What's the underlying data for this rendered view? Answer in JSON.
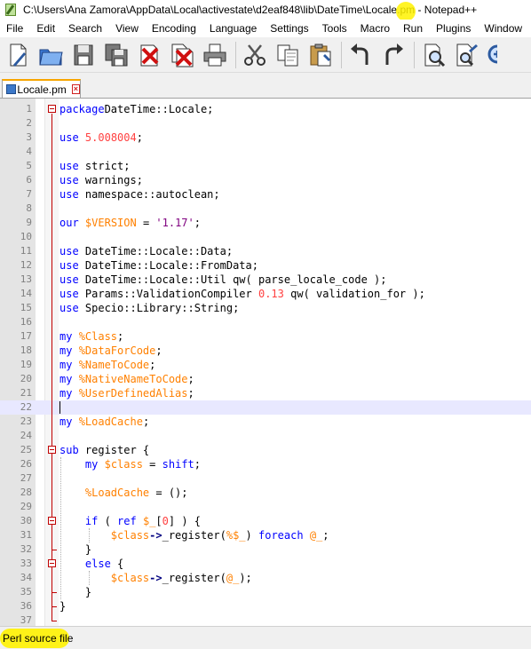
{
  "window": {
    "title": "C:\\Users\\Ana Zamora\\AppData\\Local\\activestate\\d2eaf848\\lib\\DateTime\\Locale.pm - Notepad++"
  },
  "menu": [
    "File",
    "Edit",
    "Search",
    "View",
    "Encoding",
    "Language",
    "Settings",
    "Tools",
    "Macro",
    "Run",
    "Plugins",
    "Window",
    "?"
  ],
  "toolbar": {
    "buttons": [
      "new-file-icon",
      "open-folder-icon",
      "save-icon",
      "save-all-icon",
      "close-icon",
      "close-all-icon",
      "print-icon",
      "cut-icon",
      "copy-icon",
      "paste-icon",
      "undo-icon",
      "redo-icon",
      "find-icon",
      "replace-icon",
      "zoom-icon"
    ]
  },
  "tab": {
    "label": "Locale.pm",
    "close": "×"
  },
  "editor": {
    "current_line": 22,
    "line_numbers": [
      "1",
      "2",
      "3",
      "4",
      "5",
      "6",
      "7",
      "8",
      "9",
      "10",
      "11",
      "12",
      "13",
      "14",
      "15",
      "16",
      "17",
      "18",
      "19",
      "20",
      "21",
      "22",
      "23",
      "24",
      "25",
      "26",
      "27",
      "28",
      "29",
      "30",
      "31",
      "32",
      "33",
      "34",
      "35",
      "36",
      "37"
    ],
    "lines": [
      [
        [
          "kw",
          "package"
        ],
        [
          "",
          "DateTime::Locale;"
        ]
      ],
      [],
      [
        [
          "kw",
          "use"
        ],
        [
          "",
          " "
        ],
        [
          "num",
          "5.008004"
        ],
        [
          "",
          ";"
        ]
      ],
      [],
      [
        [
          "kw",
          "use"
        ],
        [
          "",
          " strict;"
        ]
      ],
      [
        [
          "kw",
          "use"
        ],
        [
          "",
          " warnings;"
        ]
      ],
      [
        [
          "kw",
          "use"
        ],
        [
          "",
          " namespace::autoclean;"
        ]
      ],
      [],
      [
        [
          "kw",
          "our"
        ],
        [
          "",
          " "
        ],
        [
          "var",
          "$VERSION"
        ],
        [
          "",
          " = "
        ],
        [
          "str",
          "'1.17'"
        ],
        [
          "",
          ";"
        ]
      ],
      [],
      [
        [
          "kw",
          "use"
        ],
        [
          "",
          " DateTime::Locale::Data;"
        ]
      ],
      [
        [
          "kw",
          "use"
        ],
        [
          "",
          " DateTime::Locale::FromData;"
        ]
      ],
      [
        [
          "kw",
          "use"
        ],
        [
          "",
          " DateTime::Locale::Util qw( parse_locale_code );"
        ]
      ],
      [
        [
          "kw",
          "use"
        ],
        [
          "",
          " Params::ValidationCompiler "
        ],
        [
          "num",
          "0.13"
        ],
        [
          "",
          " qw( validation_for );"
        ]
      ],
      [
        [
          "kw",
          "use"
        ],
        [
          "",
          " Specio::Library::String;"
        ]
      ],
      [],
      [
        [
          "kw",
          "my"
        ],
        [
          "",
          " "
        ],
        [
          "var",
          "%Class"
        ],
        [
          "",
          ";"
        ]
      ],
      [
        [
          "kw",
          "my"
        ],
        [
          "",
          " "
        ],
        [
          "var",
          "%DataForCode"
        ],
        [
          "",
          ";"
        ]
      ],
      [
        [
          "kw",
          "my"
        ],
        [
          "",
          " "
        ],
        [
          "var",
          "%NameToCode"
        ],
        [
          "",
          ";"
        ]
      ],
      [
        [
          "kw",
          "my"
        ],
        [
          "",
          " "
        ],
        [
          "var",
          "%NativeNameToCode"
        ],
        [
          "",
          ";"
        ]
      ],
      [
        [
          "kw",
          "my"
        ],
        [
          "",
          " "
        ],
        [
          "var",
          "%UserDefinedAlias"
        ],
        [
          "",
          ";"
        ]
      ],
      [],
      [
        [
          "kw",
          "my"
        ],
        [
          "",
          " "
        ],
        [
          "var",
          "%LoadCache"
        ],
        [
          "",
          ";"
        ]
      ],
      [],
      [
        [
          "kw",
          "sub"
        ],
        [
          "",
          " register {"
        ]
      ],
      [
        [
          "",
          "    "
        ],
        [
          "kw",
          "my"
        ],
        [
          "",
          " "
        ],
        [
          "var",
          "$class"
        ],
        [
          "",
          " = "
        ],
        [
          "kw",
          "shift"
        ],
        [
          "",
          ";"
        ]
      ],
      [],
      [
        [
          "",
          "    "
        ],
        [
          "var",
          "%LoadCache"
        ],
        [
          "",
          " = ();"
        ]
      ],
      [],
      [
        [
          "",
          "    "
        ],
        [
          "kw",
          "if"
        ],
        [
          "",
          " ( "
        ],
        [
          "kw",
          "ref"
        ],
        [
          "",
          " "
        ],
        [
          "var",
          "$_"
        ],
        [
          "",
          "["
        ],
        [
          "num",
          "0"
        ],
        [
          "",
          "] ) {"
        ]
      ],
      [
        [
          "",
          "        "
        ],
        [
          "var",
          "$class"
        ],
        [
          "op",
          "->"
        ],
        [
          "",
          "_register("
        ],
        [
          "var",
          "%$_"
        ],
        [
          "",
          ") "
        ],
        [
          "kw",
          "foreach"
        ],
        [
          "",
          " "
        ],
        [
          "var",
          "@_"
        ],
        [
          "",
          ";"
        ]
      ],
      [
        [
          "",
          "    }"
        ]
      ],
      [
        [
          "",
          "    "
        ],
        [
          "kw",
          "else"
        ],
        [
          "",
          " {"
        ]
      ],
      [
        [
          "",
          "        "
        ],
        [
          "var",
          "$class"
        ],
        [
          "op",
          "->"
        ],
        [
          "",
          "_register("
        ],
        [
          "var",
          "@_"
        ],
        [
          "",
          ");"
        ]
      ],
      [
        [
          "",
          "    }"
        ]
      ],
      [
        [
          "",
          "}"
        ]
      ],
      []
    ]
  },
  "status": {
    "text": "Perl source file"
  },
  "colors": {
    "keyword": "#0000ff",
    "number": "#ff4040",
    "string": "#7f007f",
    "variable": "#ff8000",
    "fold": "#c00000",
    "tab_accent": "#f7a500",
    "highlight": "#fff200"
  }
}
